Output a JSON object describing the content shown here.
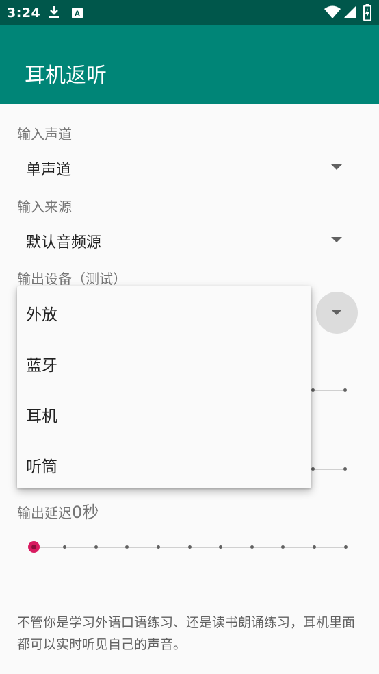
{
  "status_bar": {
    "time": "3:24",
    "icons": [
      "download-icon",
      "text-a-icon",
      "wifi-icon",
      "signal-icon",
      "battery-charging-icon"
    ]
  },
  "app_bar": {
    "title": "耳机返听"
  },
  "input_channel": {
    "label": "输入声道",
    "value": "单声道"
  },
  "input_source": {
    "label": "输入来源",
    "value": "默认音频源"
  },
  "output_device": {
    "label": "输出设备（测试）",
    "options": [
      "外放",
      "蓝牙",
      "耳机",
      "听筒"
    ]
  },
  "output_delay": {
    "label": "输出延迟",
    "value": "0秒",
    "steps": 11,
    "selected_index": 0
  },
  "description": "不管你是学习外语口语练习、还是读书朗诵练习，耳机里面都可以实时听见自己的声音。",
  "colors": {
    "accent": "#d81b60",
    "app_bar": "#008577",
    "status_bar": "#00574b"
  }
}
